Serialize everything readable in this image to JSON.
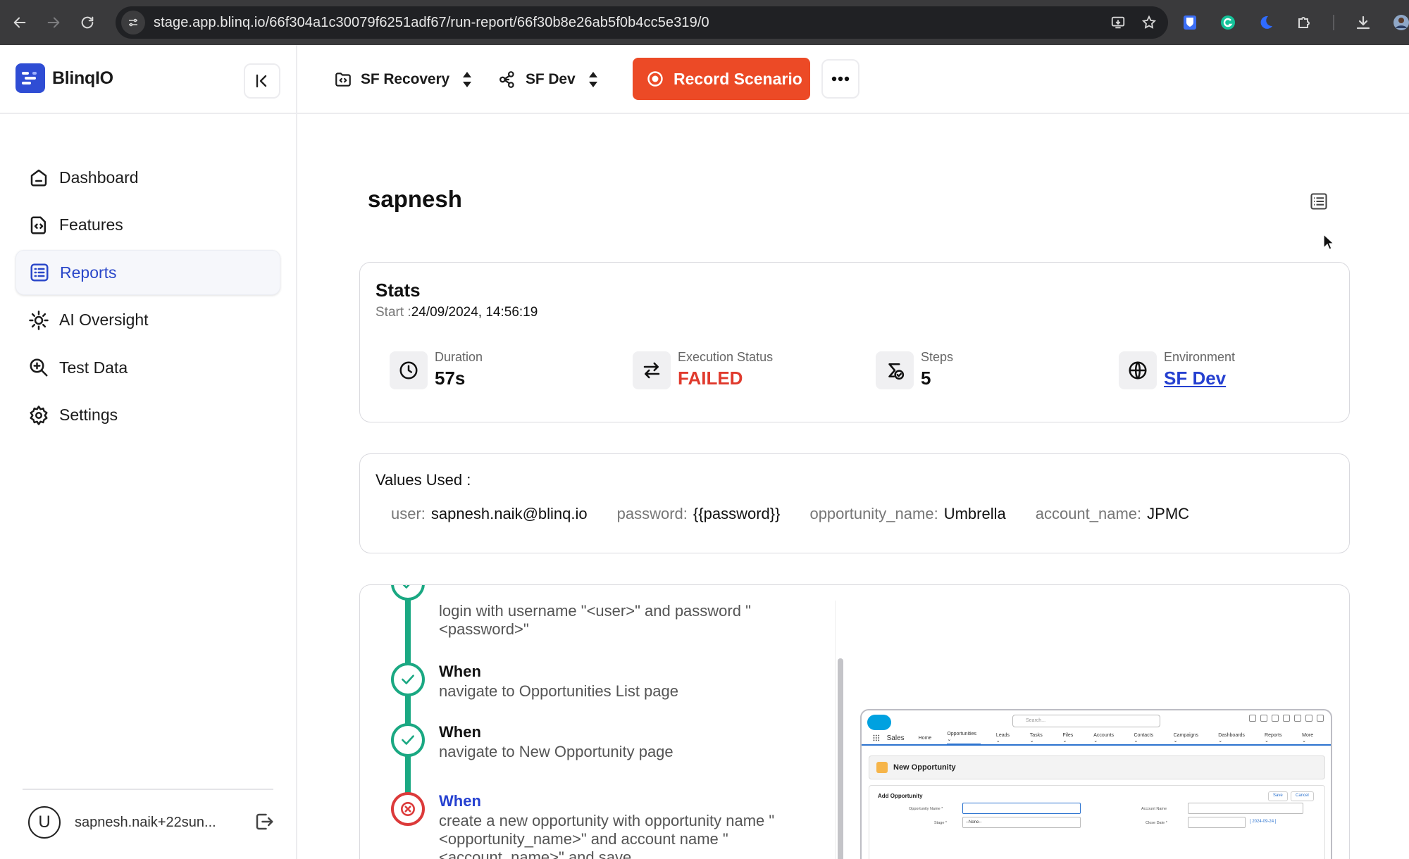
{
  "browser": {
    "url": "stage.app.blinq.io/66f304a1c30079f6251adf67/run-report/66f30b8e26ab5f0b4cc5e319/0"
  },
  "sidebar": {
    "brand": "BlinqIO",
    "items": [
      {
        "label": "Dashboard",
        "icon": "home-icon",
        "active": false
      },
      {
        "label": "Features",
        "icon": "feature-file-icon",
        "active": false
      },
      {
        "label": "Reports",
        "icon": "list-report-icon",
        "active": true
      },
      {
        "label": "AI Oversight",
        "icon": "ai-gear-icon",
        "active": false
      },
      {
        "label": "Test Data",
        "icon": "search-data-icon",
        "active": false
      },
      {
        "label": "Settings",
        "icon": "gear-icon",
        "active": false
      }
    ],
    "user": {
      "initial": "U",
      "email": "sapnesh.naik+22sun..."
    }
  },
  "topbar": {
    "project": "SF Recovery",
    "environment": "SF Dev",
    "record_label": "Record Scenario",
    "accent": "#ec4a26"
  },
  "report": {
    "title": "sapnesh",
    "stats": {
      "heading": "Stats",
      "start_label": "Start :",
      "start_value": "24/09/2024, 14:56:19",
      "duration_label": "Duration",
      "duration_value": "57s",
      "status_label": "Execution Status",
      "status_value": "FAILED",
      "steps_label": "Steps",
      "steps_value": "5",
      "env_label": "Environment",
      "env_value": "SF Dev"
    },
    "values": {
      "heading": "Values Used :",
      "pairs": [
        {
          "key": "user:",
          "value": "sapnesh.naik@blinq.io"
        },
        {
          "key": "password:",
          "value": "{{password}}"
        },
        {
          "key": "opportunity_name:",
          "value": "Umbrella"
        },
        {
          "key": "account_name:",
          "value": "JPMC"
        }
      ]
    },
    "steps": [
      {
        "keyword": "",
        "text_1": "login with username \"<user>\" and password \"",
        "text_2": "<password>\"",
        "status": "passed"
      },
      {
        "keyword": "When",
        "text_1": "navigate to Opportunities List page",
        "status": "passed"
      },
      {
        "keyword": "When",
        "text_1": "navigate to New Opportunity page",
        "status": "passed"
      },
      {
        "keyword": "When",
        "text_1": "create a new opportunity with opportunity name \"",
        "text_2": "<opportunity_name>\" and account name \"",
        "text_3": "<account_name>\" and save",
        "status": "failed"
      }
    ],
    "colors": {
      "passed": "#1aa882",
      "failed": "#dc3a3a",
      "link": "#2540d0"
    }
  },
  "preview": {
    "app": "Sales",
    "search_placeholder": "Search...",
    "nav": [
      "Home",
      "Opportunities ⌄",
      "Leads ⌄",
      "Tasks ⌄",
      "Files ⌄",
      "Accounts ⌄",
      "Contacts ⌄",
      "Campaigns ⌄",
      "Dashboards ⌄",
      "Reports ⌄",
      "More ⌄"
    ],
    "header": "New Opportunity",
    "section": "Add Opportunity",
    "save": "Save",
    "cancel": "Cancel",
    "opp_name_label": "Opportunity Name *",
    "stage_label": "Stage *",
    "stage_value": "--None--",
    "account_label": "Account Name",
    "close_label": "Close Date *",
    "close_value": "[ 2024-09-24 ]"
  }
}
